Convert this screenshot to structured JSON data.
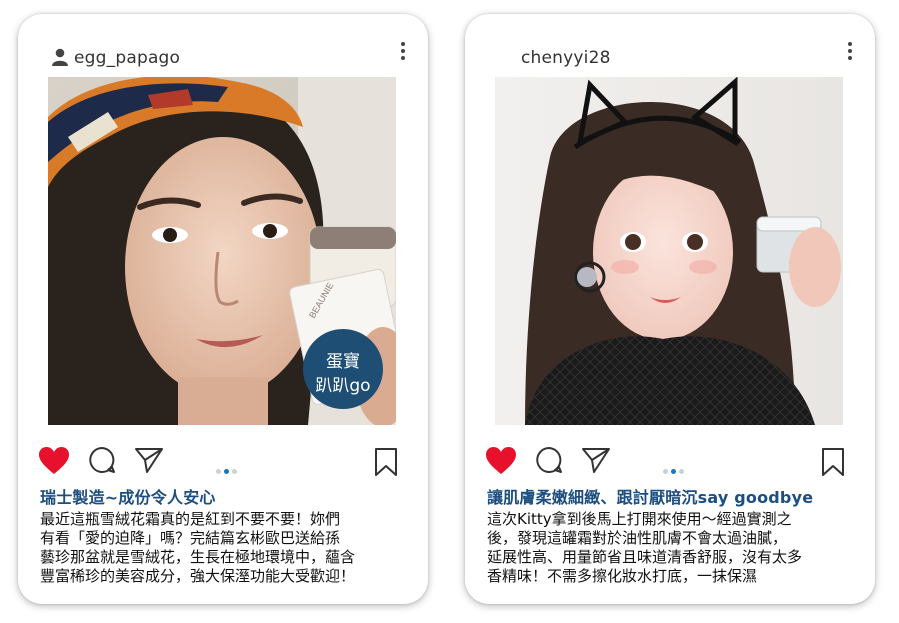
{
  "posts": [
    {
      "username": "egg_papago",
      "badge": [
        "蛋寶",
        "趴趴go"
      ],
      "product_text": "BEAUNIE",
      "title": "瑞士製造~成份令人安心",
      "body": [
        "最近這瓶雪絨花霜真的是紅到不要不要！妳們",
        "有看「愛的迫降」嗎？完結篇玄彬歐巴送給孫",
        "藝珍那盆就是雪絨花，生長在極地環境中，蘊含",
        "豐富稀珍的美容成分，強大保溼功能大受歡迎！"
      ],
      "liked": true,
      "carousel_active": 1
    },
    {
      "username": "chenyyi28",
      "title": "讓肌膚柔嫩細緻、跟討厭暗沉say goodbye",
      "body": [
        "這次Kitty拿到後馬上打開來使用～經過實測之",
        "後，發現這罐霜對於油性肌膚不會太過油膩，",
        "延展性高、用量節省且味道清香舒服，沒有太多",
        "香精味！不需多擦化妝水打底，一抹保濕"
      ],
      "liked": true,
      "carousel_active": 1
    }
  ],
  "colors": {
    "heart": "#e8112d",
    "title": "#1c4e80",
    "dot_active": "#1b75bc",
    "badge": "#1f4e75"
  },
  "icons": [
    "user-icon",
    "more-icon",
    "heart-icon",
    "comment-icon",
    "share-icon",
    "bookmark-icon"
  ]
}
